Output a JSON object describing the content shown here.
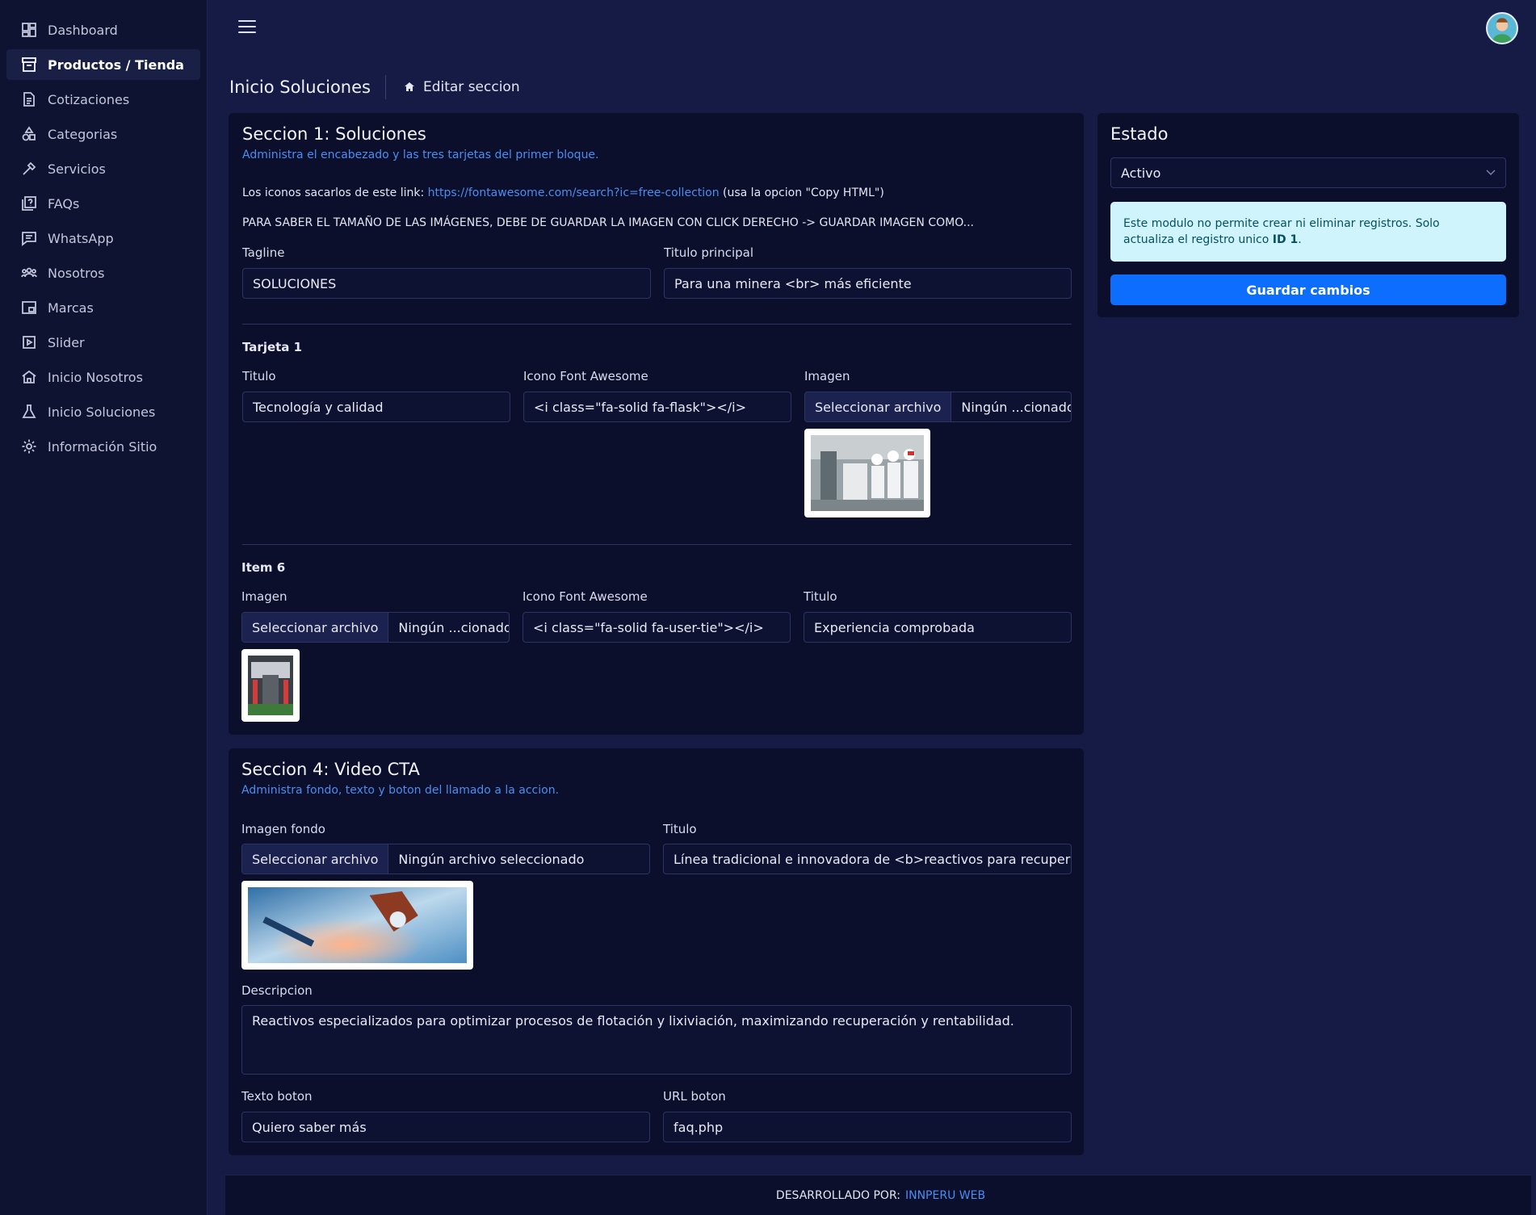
{
  "sidebar": {
    "items": [
      {
        "label": "Dashboard",
        "icon": "dashboard-icon"
      },
      {
        "label": "Productos / Tienda",
        "icon": "store-icon",
        "active": true
      },
      {
        "label": "Cotizaciones",
        "icon": "document-icon"
      },
      {
        "label": "Categorias",
        "icon": "shapes-icon"
      },
      {
        "label": "Servicios",
        "icon": "tools-icon"
      },
      {
        "label": "FAQs",
        "icon": "help-icon"
      },
      {
        "label": "WhatsApp",
        "icon": "chat-icon"
      },
      {
        "label": "Nosotros",
        "icon": "users-icon"
      },
      {
        "label": "Marcas",
        "icon": "picture-in-picture-icon"
      },
      {
        "label": "Slider",
        "icon": "play-square-icon"
      },
      {
        "label": "Inicio Nosotros",
        "icon": "home-icon"
      },
      {
        "label": "Inicio Soluciones",
        "icon": "flask-icon"
      },
      {
        "label": "Información Sitio",
        "icon": "gear-icon"
      }
    ]
  },
  "header": {
    "title": "Inicio Soluciones",
    "subtitle": "Editar seccion"
  },
  "section1": {
    "title": "Seccion 1: Soluciones",
    "subtitle": "Administra el encabezado y las tres tarjetas del primer bloque.",
    "note_prefix": "Los iconos sacarlos de este link: ",
    "note_link": "https://fontawesome.com/search?ic=free-collection",
    "note_suffix": " (usa la opcion \"Copy HTML\")",
    "warning": "PARA SABER EL TAMAÑO DE LAS IMÁGENES, DEBE DE GUARDAR LA IMAGEN CON CLICK DERECHO -> GUARDAR IMAGEN COMO...",
    "tagline_label": "Tagline",
    "tagline_value": "SOLUCIONES",
    "main_title_label": "Titulo principal",
    "main_title_value": "Para una minera <br> más eficiente",
    "card1": {
      "heading": "Tarjeta 1",
      "title_label": "Titulo",
      "title_value": "Tecnología y calidad",
      "icon_label": "Icono Font Awesome",
      "icon_value": "<i class=\"fa-solid fa-flask\"></i>",
      "image_label": "Imagen",
      "file_button": "Seleccionar archivo",
      "file_text": "Ningún ...cionado"
    },
    "item6": {
      "heading": "Item 6",
      "image_label": "Imagen",
      "file_button": "Seleccionar archivo",
      "file_text": "Ningún ...cionado",
      "icon_label": "Icono Font Awesome",
      "icon_value": "<i class=\"fa-solid fa-user-tie\"></i>",
      "title_label": "Titulo",
      "title_value": "Experiencia comprobada"
    }
  },
  "section4": {
    "title": "Seccion 4: Video CTA",
    "subtitle": "Administra fondo, texto y boton del llamado a la accion.",
    "bg_label": "Imagen fondo",
    "file_button": "Seleccionar archivo",
    "file_text": "Ningún archivo seleccionado",
    "title_label": "Titulo",
    "title_value": "Línea tradicional e innovadora de <b>reactivos para recuperació",
    "desc_label": "Descripcion",
    "desc_value": "Reactivos especializados para optimizar procesos de flotación y lixiviación, maximizando recuperación y rentabilidad.",
    "btn_text_label": "Texto boton",
    "btn_text_value": "Quiero saber más",
    "btn_url_label": "URL boton",
    "btn_url_value": "faq.php"
  },
  "estado": {
    "title": "Estado",
    "select_value": "Activo",
    "alert_text": "Este modulo no permite crear ni eliminar registros. Solo actualiza el registro unico ",
    "alert_bold": "ID 1",
    "alert_end": ".",
    "save_button": "Guardar cambios"
  },
  "footer": {
    "prefix": "DESARROLLADO POR:",
    "link": "INNPERU WEB"
  },
  "colors": {
    "background": "#151b45",
    "sidebar": "#0e1331",
    "card": "#0b0f2c",
    "accent": "#0d6efd",
    "link": "#4b8df0"
  }
}
